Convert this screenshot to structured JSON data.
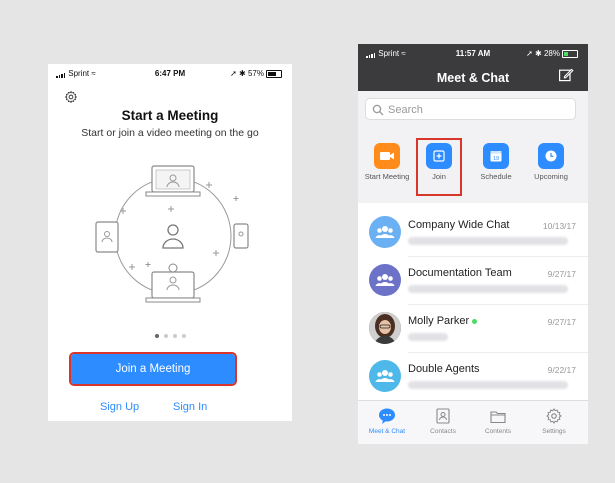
{
  "left_screen": {
    "status": {
      "carrier": "Sprint",
      "time": "6:47 PM",
      "battery": "57%"
    },
    "title": "Start a Meeting",
    "subtitle": "Start or join a video meeting on the go",
    "page_dots": 4,
    "active_dot": 0,
    "join_button": "Join a Meeting",
    "sign_up": "Sign Up",
    "sign_in": "Sign In",
    "accent": "#2d8cff",
    "highlight": "#d9362b"
  },
  "right_screen": {
    "status": {
      "carrier": "Sprint",
      "time": "11:57 AM",
      "battery": "28%"
    },
    "title": "Meet & Chat",
    "search_placeholder": "Search",
    "actions": [
      {
        "label": "Start Meeting",
        "icon": "video-camera-icon",
        "color": "#ff8c1a"
      },
      {
        "label": "Join",
        "icon": "plus-icon",
        "color": "#2d8cff"
      },
      {
        "label": "Schedule",
        "icon": "calendar-icon",
        "color": "#2d8cff"
      },
      {
        "label": "Upcoming",
        "icon": "clock-icon",
        "color": "#2d8cff"
      }
    ],
    "chats": [
      {
        "name": "Company Wide Chat",
        "date": "10/13/17",
        "avatar": "group-avatar-icon",
        "color": "#6bb0f2"
      },
      {
        "name": "Documentation Team",
        "date": "9/27/17",
        "avatar": "group-avatar-icon",
        "color": "#6b72c8"
      },
      {
        "name": "Molly Parker",
        "date": "9/27/17",
        "avatar": "photo-avatar",
        "color": "#6b4a3a",
        "online": true
      },
      {
        "name": "Double Agents",
        "date": "9/22/17",
        "avatar": "group-avatar-icon",
        "color": "#4fb8ea"
      }
    ],
    "tabs": [
      {
        "label": "Meet & Chat",
        "icon": "chat-bubble-icon",
        "active": true
      },
      {
        "label": "Contacts",
        "icon": "contacts-icon",
        "active": false
      },
      {
        "label": "Contents",
        "icon": "folder-icon",
        "active": false
      },
      {
        "label": "Settings",
        "icon": "gear-icon",
        "active": false
      }
    ]
  }
}
